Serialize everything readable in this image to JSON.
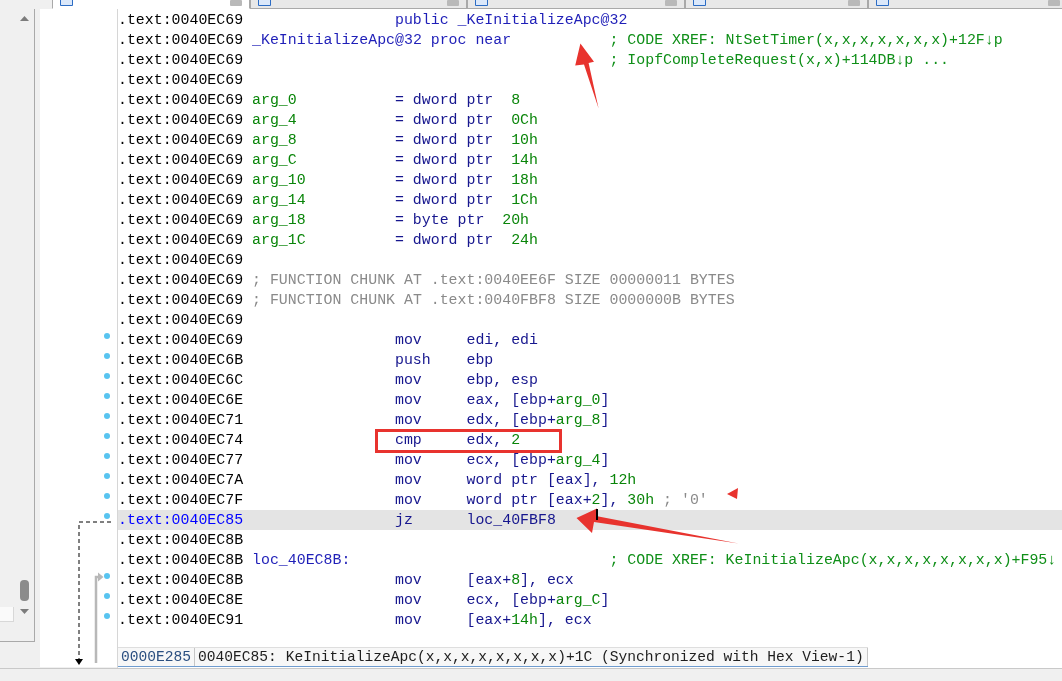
{
  "tabs": [
    {
      "selected": true
    },
    {
      "selected": false
    },
    {
      "selected": false
    },
    {
      "selected": false
    },
    {
      "selected": false
    }
  ],
  "lines": [
    {
      "address": ".text:0040EC69",
      "selected": false,
      "dot": false,
      "directive": [
        {
          "text": "public _KeInitializeApc@32",
          "kind": "name"
        }
      ]
    },
    {
      "address": ".text:0040EC69",
      "selected": false,
      "dot": false,
      "label": {
        "text": "_KeInitializeApc@32 proc near",
        "kind": "name"
      },
      "comment": {
        "text": "; CODE XREF: NtSetTimer(x,x,x,x,x,x,x)+12F↓p",
        "kind": "xref"
      },
      "annotations": [
        {
          "kind": "arrow-up"
        }
      ]
    },
    {
      "address": ".text:0040EC69",
      "selected": false,
      "dot": false,
      "comment": {
        "text": "; IopfCompleteRequest(x,x)+114DB↓p ...",
        "kind": "xref"
      }
    },
    {
      "address": ".text:0040EC69",
      "selected": false,
      "dot": false
    },
    {
      "address": ".text:0040EC69",
      "selected": false,
      "dot": false,
      "label": {
        "text": "arg_0",
        "kind": "arg"
      },
      "directive": [
        {
          "text": "= dword ptr  ",
          "kind": "code"
        },
        {
          "text": "8",
          "kind": "number"
        }
      ]
    },
    {
      "address": ".text:0040EC69",
      "selected": false,
      "dot": false,
      "label": {
        "text": "arg_4",
        "kind": "arg"
      },
      "directive": [
        {
          "text": "= dword ptr  ",
          "kind": "code"
        },
        {
          "text": "0Ch",
          "kind": "number"
        }
      ]
    },
    {
      "address": ".text:0040EC69",
      "selected": false,
      "dot": false,
      "label": {
        "text": "arg_8",
        "kind": "arg"
      },
      "directive": [
        {
          "text": "= dword ptr  ",
          "kind": "code"
        },
        {
          "text": "10h",
          "kind": "number"
        }
      ]
    },
    {
      "address": ".text:0040EC69",
      "selected": false,
      "dot": false,
      "label": {
        "text": "arg_C",
        "kind": "arg"
      },
      "directive": [
        {
          "text": "= dword ptr  ",
          "kind": "code"
        },
        {
          "text": "14h",
          "kind": "number"
        }
      ]
    },
    {
      "address": ".text:0040EC69",
      "selected": false,
      "dot": false,
      "label": {
        "text": "arg_10",
        "kind": "arg"
      },
      "directive": [
        {
          "text": "= dword ptr  ",
          "kind": "code"
        },
        {
          "text": "18h",
          "kind": "number"
        }
      ]
    },
    {
      "address": ".text:0040EC69",
      "selected": false,
      "dot": false,
      "label": {
        "text": "arg_14",
        "kind": "arg"
      },
      "directive": [
        {
          "text": "= dword ptr  ",
          "kind": "code"
        },
        {
          "text": "1Ch",
          "kind": "number"
        }
      ]
    },
    {
      "address": ".text:0040EC69",
      "selected": false,
      "dot": false,
      "label": {
        "text": "arg_18",
        "kind": "arg"
      },
      "directive": [
        {
          "text": "= byte ptr  ",
          "kind": "code"
        },
        {
          "text": "20h",
          "kind": "number"
        }
      ]
    },
    {
      "address": ".text:0040EC69",
      "selected": false,
      "dot": false,
      "label": {
        "text": "arg_1C",
        "kind": "arg"
      },
      "directive": [
        {
          "text": "= dword ptr  ",
          "kind": "code"
        },
        {
          "text": "24h",
          "kind": "number"
        }
      ]
    },
    {
      "address": ".text:0040EC69",
      "selected": false,
      "dot": false
    },
    {
      "address": ".text:0040EC69",
      "selected": false,
      "dot": false,
      "comment": {
        "text": "; FUNCTION CHUNK AT .text:0040EE6F SIZE 00000011 BYTES",
        "kind": "chunk"
      }
    },
    {
      "address": ".text:0040EC69",
      "selected": false,
      "dot": false,
      "comment": {
        "text": "; FUNCTION CHUNK AT .text:0040FBF8 SIZE 0000000B BYTES",
        "kind": "chunk"
      }
    },
    {
      "address": ".text:0040EC69",
      "selected": false,
      "dot": false
    },
    {
      "address": ".text:0040EC69",
      "selected": false,
      "dot": true,
      "mnemonic": "mov",
      "operands": [
        {
          "text": "edi, edi",
          "kind": "code"
        }
      ]
    },
    {
      "address": ".text:0040EC6B",
      "selected": false,
      "dot": true,
      "mnemonic": "push",
      "operands": [
        {
          "text": "ebp",
          "kind": "code"
        }
      ]
    },
    {
      "address": ".text:0040EC6C",
      "selected": false,
      "dot": true,
      "mnemonic": "mov",
      "operands": [
        {
          "text": "ebp, esp",
          "kind": "code"
        }
      ]
    },
    {
      "address": ".text:0040EC6E",
      "selected": false,
      "dot": true,
      "mnemonic": "mov",
      "operands": [
        {
          "text": "eax, [ebp+",
          "kind": "code"
        },
        {
          "text": "arg_0",
          "kind": "arg"
        },
        {
          "text": "]",
          "kind": "code"
        }
      ]
    },
    {
      "address": ".text:0040EC71",
      "selected": false,
      "dot": true,
      "mnemonic": "mov",
      "operands": [
        {
          "text": "edx, [ebp+",
          "kind": "code"
        },
        {
          "text": "arg_8",
          "kind": "arg"
        },
        {
          "text": "]",
          "kind": "code"
        }
      ]
    },
    {
      "address": ".text:0040EC74",
      "selected": false,
      "dot": true,
      "mnemonic": "cmp",
      "operands": [
        {
          "text": "edx, ",
          "kind": "code"
        },
        {
          "text": "2",
          "kind": "number"
        }
      ],
      "annotations": [
        {
          "kind": "box"
        }
      ]
    },
    {
      "address": ".text:0040EC77",
      "selected": false,
      "dot": true,
      "mnemonic": "mov",
      "operands": [
        {
          "text": "ecx, [ebp+",
          "kind": "code"
        },
        {
          "text": "arg_4",
          "kind": "arg"
        },
        {
          "text": "]",
          "kind": "code"
        }
      ]
    },
    {
      "address": ".text:0040EC7A",
      "selected": false,
      "dot": true,
      "mnemonic": "mov",
      "operands": [
        {
          "text": "word ptr [eax], ",
          "kind": "code"
        },
        {
          "text": "12h",
          "kind": "number"
        }
      ]
    },
    {
      "address": ".text:0040EC7F",
      "selected": false,
      "dot": true,
      "mnemonic": "mov",
      "operands": [
        {
          "text": "word ptr [eax+",
          "kind": "code"
        },
        {
          "text": "2",
          "kind": "number"
        },
        {
          "text": "], ",
          "kind": "code"
        },
        {
          "text": "30h",
          "kind": "number"
        },
        {
          "text": " ; '0'",
          "kind": "comment"
        }
      ],
      "annotations": [
        {
          "kind": "pointer"
        }
      ]
    },
    {
      "address": ".text:0040EC85",
      "selected": true,
      "dot": true,
      "mnemonic": "jz",
      "operands": [
        {
          "text": "loc_40FBF8",
          "kind": "code"
        }
      ],
      "jump": {
        "kind": "out"
      },
      "annotations": [
        {
          "kind": "arrow-left"
        },
        {
          "kind": "cursor"
        }
      ]
    },
    {
      "address": ".text:0040EC8B",
      "selected": false,
      "dot": false
    },
    {
      "address": ".text:0040EC8B",
      "selected": false,
      "dot": false,
      "label": {
        "text": "loc_40EC8B:",
        "kind": "name"
      },
      "comment": {
        "text": "; CODE XREF: KeInitializeApc(x,x,x,x,x,x,x,x)+F95↓",
        "kind": "xref"
      }
    },
    {
      "address": ".text:0040EC8B",
      "selected": false,
      "dot": true,
      "mnemonic": "mov",
      "operands": [
        {
          "text": "[eax+",
          "kind": "code"
        },
        {
          "text": "8",
          "kind": "number"
        },
        {
          "text": "], ecx",
          "kind": "code"
        }
      ],
      "jump": {
        "kind": "in"
      }
    },
    {
      "address": ".text:0040EC8E",
      "selected": false,
      "dot": true,
      "mnemonic": "mov",
      "operands": [
        {
          "text": "ecx, [ebp+",
          "kind": "code"
        },
        {
          "text": "arg_C",
          "kind": "arg"
        },
        {
          "text": "]",
          "kind": "code"
        }
      ]
    },
    {
      "address": ".text:0040EC91",
      "selected": false,
      "dot": true,
      "mnemonic": "mov",
      "operands": [
        {
          "text": "[eax+",
          "kind": "code"
        },
        {
          "text": "14h",
          "kind": "number"
        },
        {
          "text": "], ecx",
          "kind": "code"
        }
      ]
    }
  ],
  "status_bar": {
    "offset": "0000E285",
    "location": "0040EC85: KeInitializeApc(x,x,x,x,x,x,x,x)+1C (Synchronized with Hex View-1)"
  }
}
